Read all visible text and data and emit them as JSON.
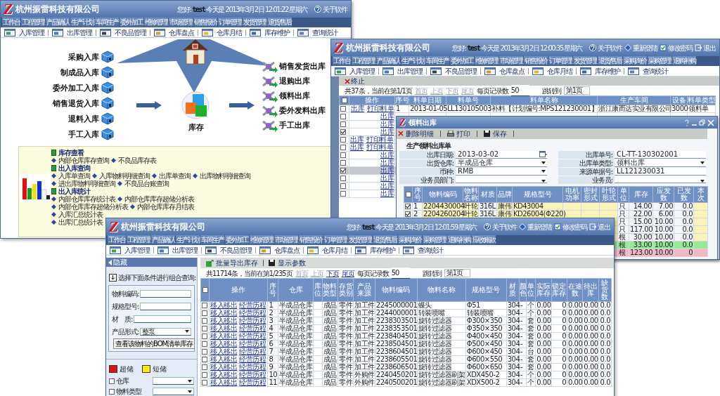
{
  "window_main": {
    "logo": "Z",
    "company": "杭州振雷科技有限公司",
    "greeting": "您好:",
    "user": "test",
    "today": "今天是 2013年3月2日 12:01:22 星期六",
    "header_links": [
      "关于软件"
    ],
    "nav_tabs": [
      "工作台",
      "工程管理",
      "产品确认",
      "生产计划",
      "车间生产",
      "委外加工",
      "维修管理",
      "市场管理",
      "销售报价",
      "订单管理",
      "发货管理",
      "退货/售后"
    ],
    "toolbar": [
      "入库管理",
      "出库管理",
      "不良品管理",
      "仓库盘点",
      "仓库月结",
      "库存维护",
      "查询统计"
    ],
    "diagram": {
      "inbound": [
        "采购入库",
        "制成品入库",
        "委外加工入库",
        "销售退货入库",
        "退料入库",
        "手工入库"
      ],
      "center": "库存",
      "outbound": [
        "销售发货出库",
        "退购出库",
        "领料出库",
        "委外发料出库",
        "手工出库"
      ]
    },
    "report_panel": [
      {
        "title": "库存查看",
        "lines": [
          [
            "内部仓库库存查询",
            "不良品库存表"
          ]
        ]
      },
      {
        "title": "出入库查询",
        "lines": [
          [
            "入库单查询",
            "入库物料明细查询",
            "出库单查询",
            "出库物料明细查询"
          ],
          [
            "进出库物料明细查询",
            "不良品台账查询"
          ]
        ]
      },
      {
        "title": "出入库统计",
        "lines": [
          [
            "内部仓库库存统计表",
            "内部仓库库存超储分析表"
          ],
          [
            "内部仓库库存超储分析表",
            "内部仓库库存月结表"
          ],
          [
            "入库汇总统计表"
          ],
          [
            "出库汇总统计表"
          ]
        ]
      }
    ]
  },
  "window_orders": {
    "logo": "Z",
    "company": "杭州振雷科技有限公司",
    "greeting": "您好:",
    "user": "test",
    "today": "今天是 2013年3月2日 12:00:35 星期六",
    "header_links": [
      "关于软件",
      "重新登陆",
      "修改密码",
      "退出"
    ],
    "nav_tabs": [
      "工作台",
      "工程管理",
      "产品确认",
      "生产计划",
      "车间生产",
      "委外加工",
      "维修管理",
      "市场管理",
      "销售报价",
      "订单管理",
      "发货管理",
      "退货/售后",
      "采购询价",
      "采购管理",
      "退购补购"
    ],
    "toolbar": [
      "入库管理",
      "出库管理",
      "不良品管理",
      "仓库盘点",
      "仓库月结",
      "库存维护",
      "查询统计"
    ],
    "action": "终止",
    "pager": {
      "summary": "共37条，当前在第1/1页",
      "pages": [
        {
          "label": "首页",
          "disabled": true
        },
        {
          "label": "上页",
          "disabled": true
        },
        {
          "label": "下页",
          "disabled": true
        },
        {
          "label": "尾页",
          "disabled": true
        }
      ],
      "per_page_label": "每页记录数",
      "per_page": "50",
      "jump_label": "跳转到",
      "page": "第1页"
    },
    "all_checked": false,
    "columns": [
      "操作",
      "序号",
      "料单日期",
      "料单号",
      "料单名称",
      "生产车间",
      "设备",
      "料单类型"
    ],
    "rows": [
      {
        "checked": false,
        "selected": false,
        "links": [
          "出库",
          "打印料单"
        ],
        "no": "1",
        "date": "2013-01-05",
        "doc_no": "LL130105003",
        "name": "补料【计划编号:MPS121230001】",
        "workshop": "浙江康而达实业有限公司",
        "device": "3000",
        "type": "领料单"
      },
      {
        "checked": false,
        "selected": false,
        "links": [
          "出库"
        ]
      },
      {
        "checked": false,
        "selected": false,
        "links": [
          "出库"
        ]
      },
      {
        "checked": true,
        "selected": false,
        "links": [
          "出库"
        ]
      },
      {
        "checked": false,
        "selected": false,
        "links": [
          "出库",
          "打印料单"
        ]
      },
      {
        "checked": false,
        "selected": false,
        "links": [
          "出库",
          "打印料单"
        ]
      },
      {
        "checked": false,
        "selected": false,
        "links": [
          "出库"
        ]
      },
      {
        "checked": false,
        "selected": false,
        "links": [
          "出库"
        ]
      },
      {
        "checked": true,
        "selected": true,
        "links": [
          "出库"
        ]
      },
      {
        "checked": false,
        "selected": false,
        "links": [
          "出库"
        ]
      },
      {
        "checked": false,
        "selected": false,
        "links": [
          "出库"
        ]
      },
      {
        "checked": false,
        "selected": false,
        "links": [
          "出库"
        ]
      }
    ]
  },
  "dialog": {
    "logo": "Z",
    "title": "领料出库",
    "toolbar": [
      "删除明细",
      "打印",
      "保存"
    ],
    "tab": "生产领料出库单",
    "fields_left": [
      {
        "label": "出库日期:",
        "value": "2013-03-02",
        "kind": "date"
      },
      {
        "label": "出货仓库:",
        "value": "半成品仓库",
        "kind": "select"
      },
      {
        "label": "币种:",
        "value": "RMB",
        "kind": "select"
      },
      {
        "label": "业务员部门:",
        "kind": "select"
      }
    ],
    "fields_right": [
      {
        "label": "出库单号:",
        "value": "CL-TT-130302001",
        "kind": "text"
      },
      {
        "label": "出库单类型:",
        "value": "领料出库",
        "kind": "select"
      },
      {
        "label": "来源单据号:",
        "value": "LL121230031",
        "kind": "text"
      },
      {
        "label": "业务员:",
        "kind": "select"
      }
    ],
    "all_checked": false,
    "columns": [
      "序号",
      "物料编码",
      "物料名称",
      "材质",
      "品牌",
      "规格型号",
      "电机功率",
      "密封形式",
      "叶轮形式",
      "单位",
      "库存",
      "应发数",
      "已发数",
      "本次"
    ],
    "rows": [
      {
        "checked": true,
        "no": "1",
        "code": "2204430004",
        "name": "叶轮",
        "material": "316L",
        "brand": "康伟",
        "spec": "KD43004",
        "unit": "只",
        "stock": "14.00",
        "due": "7.00",
        "issued": "0.0"
      },
      {
        "checked": true,
        "no": "2",
        "code": "2204260204",
        "name": "叶轮",
        "material": "316L",
        "brand": "康伟",
        "spec": "KD26004(Φ220)",
        "unit": "只",
        "stock": "22.00",
        "due": "6.00",
        "issued": "0.0"
      },
      {
        "unit": "只",
        "stock": "15.00",
        "due": "10.00",
        "issued": "0.0"
      },
      {
        "unit": "只",
        "stock": "117.00",
        "due": "10.00",
        "issued": "0.0"
      },
      {
        "unit": "根",
        "stock": "30.00",
        "due": "10.00",
        "issued": "0.0"
      },
      {
        "unit": "根",
        "stock": "33.00",
        "due": "10.00",
        "issued": "0.0",
        "color": "#98e898"
      },
      {
        "unit": "根",
        "stock": "123.00",
        "due": "10.00",
        "issued": "0",
        "color": "#f4b6c2"
      }
    ]
  },
  "window_stock": {
    "logo": "Z",
    "company": "杭州振雷科技有限公司",
    "greeting": "您好:",
    "user": "test",
    "today": "今天是 2013年3月2日 12:01:59 星期六",
    "header_links": [
      "关于软件",
      "重新登陆",
      "修改密码",
      "退出"
    ],
    "nav_tabs": [
      "工作台",
      "工程管理",
      "产品确认",
      "生产计划",
      "车间生产",
      "委外加工",
      "维修管理",
      "市场管理",
      "销售报价",
      "订单管理",
      "发货管理",
      "退货/售后",
      "采购询价",
      "采购管理",
      "退购补购",
      "应收账款"
    ],
    "toolbar": [
      "入库管理",
      "出库管理",
      "不良品管理",
      "仓库盘点",
      "仓库月结",
      "库存维护",
      "查询统计"
    ],
    "side_panel": {
      "title": "隐藏",
      "hint": "选择下面条件进行组合查询:",
      "filters": [
        {
          "label": "物料编码:",
          "kind": "text"
        },
        {
          "label": "规格型号:",
          "kind": "text"
        },
        {
          "label": "材　质:",
          "kind": "text"
        },
        {
          "label": "产品形式:",
          "kind": "select",
          "value": "整泵"
        }
      ],
      "button": "查看该物料的BOM清单库存",
      "legend": [
        {
          "label": "超储",
          "color": "#e01010"
        },
        {
          "label": "短储",
          "color": "#f8f000"
        }
      ],
      "options": [
        {
          "label": "仓库",
          "checked": false
        },
        {
          "label": "物料类型",
          "checked": false
        }
      ]
    },
    "actions": [
      "批量导出库存",
      "显示参数"
    ],
    "pager": {
      "summary": "共11714条，当前在第1/235页",
      "pages": [
        {
          "label": "首页",
          "disabled": true
        },
        {
          "label": "上页",
          "disabled": true
        },
        {
          "label": "下页",
          "disabled": false
        },
        {
          "label": "尾页",
          "disabled": false
        }
      ],
      "per_page_label": "每页记录数",
      "per_page": "50",
      "jump_label": "跳转到",
      "page": "第1页"
    },
    "all_checked": false,
    "columns": [
      "操作",
      "序号",
      "仓库",
      "库位",
      "物料类型",
      "存货类别",
      "产品来源",
      "物料编码",
      "物料名称",
      "规格型号",
      "材质",
      "颜色",
      "单位",
      "实际库存",
      "锁定库存",
      "在途数",
      "待出库",
      "缺货数"
    ],
    "rows": [
      {
        "checked": false,
        "links": [
          "移入移出",
          "经营历程"
        ],
        "no": "1",
        "warehouse": "半成品仓库",
        "type": "成品",
        "category": "零件",
        "source": "加工件",
        "code": "2245000001",
        "name": "蝶头",
        "spec": "Φ51",
        "material": "304",
        "column_12": "-",
        "unit": "个",
        "stock": "0.00",
        "locked": "0",
        "transit": "0.00",
        "pending": "0.00",
        "short": "0.0"
      },
      {
        "checked": false,
        "links": [
          "移入移出",
          "经营历程"
        ],
        "no": "2",
        "warehouse": "半成品仓库",
        "type": "成品",
        "category": "零件",
        "source": "加工件",
        "code": "2244000001",
        "name": "转装喷嘴",
        "spec": "转装喷嘴",
        "material": "304",
        "column_12": "-",
        "unit": "个",
        "stock": "0.00",
        "locked": "0",
        "transit": "0.00",
        "pending": "0.00",
        "short": "0.0"
      },
      {
        "checked": false,
        "links": [
          "移入移出",
          "经营历程"
        ],
        "no": "3",
        "warehouse": "半成品仓库",
        "type": "成品",
        "category": "零件",
        "source": "加工件",
        "code": "2238303501",
        "name": "旋转过滤器",
        "spec": "Φ300×350",
        "material": "304",
        "column_12": "-",
        "unit": "套",
        "stock": "0.00",
        "locked": "0",
        "transit": "0.00",
        "pending": "0.00",
        "short": "0.0"
      },
      {
        "checked": false,
        "links": [
          "移入移出",
          "经营历程"
        ],
        "no": "4",
        "warehouse": "半成品仓库",
        "type": "成品",
        "category": "零件",
        "source": "加工件",
        "code": "2238353501",
        "name": "旋转过滤器",
        "spec": "Φ350×350",
        "material": "304",
        "column_12": "-",
        "unit": "套",
        "stock": "0.00",
        "locked": "0",
        "transit": "0.00",
        "pending": "0.00",
        "short": "0.0"
      },
      {
        "checked": false,
        "links": [
          "移入移出",
          "经营历程"
        ],
        "no": "5",
        "warehouse": "半成品仓库",
        "type": "成品",
        "category": "零件",
        "source": "加工件",
        "code": "2238404501",
        "name": "旋转过滤器",
        "spec": "Φ400×450",
        "material": "304",
        "column_12": "-",
        "unit": "套",
        "stock": "0.00",
        "locked": "0",
        "transit": "0.00",
        "pending": "0.00",
        "short": "0.0"
      },
      {
        "checked": false,
        "links": [
          "移入移出",
          "经营历程"
        ],
        "no": "6",
        "warehouse": "半成品仓库",
        "type": "成品",
        "category": "零件",
        "source": "加工件",
        "code": "2238504501",
        "name": "旋转过滤器",
        "spec": "Φ500×450",
        "material": "304",
        "column_12": "-",
        "unit": "套",
        "stock": "0.00",
        "locked": "0",
        "transit": "0.00",
        "pending": "0.00",
        "short": "0.0"
      },
      {
        "checked": false,
        "links": [
          "移入移出",
          "经营历程"
        ],
        "no": "7",
        "warehouse": "半成品仓库",
        "type": "成品",
        "category": "零件",
        "source": "加工件",
        "code": "2238604501",
        "name": "旋转过滤器",
        "spec": "Φ600×450",
        "material": "304",
        "column_12": "-",
        "unit": "台",
        "stock": "0.00",
        "locked": "0",
        "transit": "0.00",
        "pending": "0.00",
        "short": "0.0"
      },
      {
        "checked": false,
        "links": [
          "移入移出",
          "经营历程"
        ],
        "no": "8",
        "warehouse": "半成品仓库",
        "type": "成品",
        "category": "零件",
        "source": "加工件",
        "code": "2238605501",
        "name": "旋转过滤器",
        "spec": "Φ600×550",
        "material": "304",
        "column_12": "-",
        "unit": "套",
        "stock": "0.00",
        "locked": "0",
        "transit": "0.00",
        "pending": "0.00",
        "short": "0.0"
      },
      {
        "checked": false,
        "links": [
          "移入移出",
          "经营历程"
        ],
        "no": "9",
        "warehouse": "半成品仓库",
        "type": "成品",
        "category": "零件",
        "source": "加工件",
        "code": "2238606501",
        "name": "旋转过滤器",
        "spec": "Φ600×650",
        "material": "304",
        "column_12": "-",
        "unit": "套",
        "stock": "0.00",
        "locked": "0",
        "transit": "0.00",
        "pending": "0.00",
        "short": "0.0"
      },
      {
        "checked": false,
        "links": [
          "移入移出",
          "经营历程"
        ],
        "no": "10",
        "warehouse": "半成品仓库",
        "type": "成品",
        "category": "零件",
        "source": "外购件",
        "code": "2240450201",
        "name": "旋转过滤器刷架",
        "spec": "XDX450-2",
        "material": "304",
        "column_12": "-",
        "unit": "个",
        "stock": "0.00",
        "locked": "0",
        "transit": "0.00",
        "pending": "0.00",
        "short": "0.0"
      },
      {
        "checked": false,
        "links": [
          "移入移出",
          "经营历程"
        ],
        "no": "11",
        "warehouse": "半成品仓库",
        "type": "成品",
        "category": "零件",
        "source": "外购件",
        "code": "2240500201",
        "name": "旋转过滤器刷架",
        "spec": "XDX500-2",
        "material": "304",
        "column_12": "-",
        "unit": "个",
        "stock": "0.00",
        "locked": "0",
        "transit": "0.00",
        "pending": "0.00",
        "short": "0.0"
      }
    ]
  }
}
